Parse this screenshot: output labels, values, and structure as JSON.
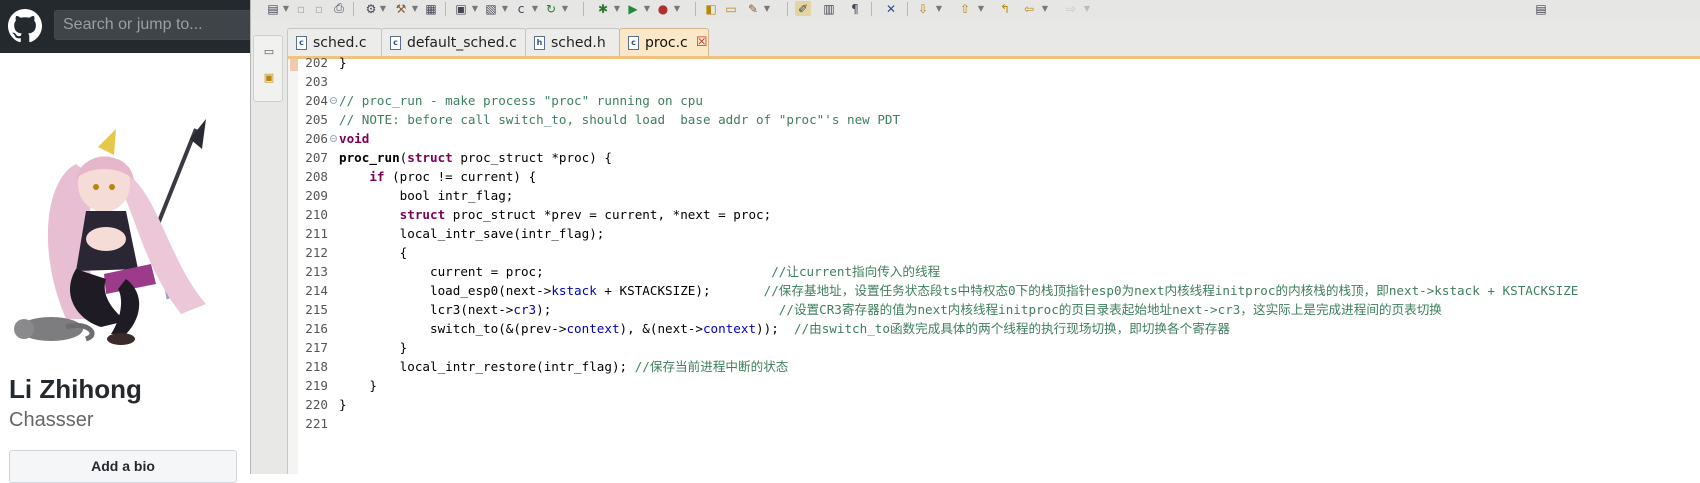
{
  "github": {
    "search_placeholder": "Search or jump to...",
    "profile_name": "Li Zhihong",
    "profile_login": "Chassser",
    "bio_button_label": "Add a bio",
    "header_color": "#24292e"
  },
  "eclipse": {
    "tabs": [
      {
        "label": "sched.c",
        "icon": "c-file-icon"
      },
      {
        "label": "default_sched.c",
        "icon": "c-file-icon"
      },
      {
        "label": "sched.h",
        "icon": "h-file-icon"
      },
      {
        "label": "proc.c",
        "icon": "c-file-icon",
        "active": true
      }
    ],
    "tab_close_glyph": "☒",
    "line_numbers": [
      "202",
      "203",
      "204",
      "205",
      "206",
      "207",
      "208",
      "209",
      "210",
      "211",
      "212",
      "213",
      "214",
      "215",
      "216",
      "217",
      "218",
      "219",
      "220",
      "221"
    ],
    "code": {
      "l202": "}",
      "l204_comment": "// proc_run - make process \"proc\" running on cpu",
      "l205_comment": "// NOTE: before call switch_to, should load  base addr of \"proc\"'s new PDT",
      "l206_kw": "void",
      "l207_fn": "proc_run",
      "l207_paren": "(",
      "l207_kw": "struct",
      "l207_rest": " proc_struct *proc) {",
      "l208_indent": "    ",
      "l208_kw": "if",
      "l208_rest": " (proc != current) {",
      "l209": "        bool intr_flag;",
      "l210_indent": "        ",
      "l210_kw": "struct",
      "l210_rest": " proc_struct *prev = current, *next = proc;",
      "l211": "        local_intr_save(intr_flag);",
      "l212": "        {",
      "l213_code": "            current = proc;                              ",
      "l213_comment": "//让current指向传入的线程",
      "l214_a": "            load_esp0(next->",
      "l214_fld": "kstack",
      "l214_b": " + KSTACKSIZE);       ",
      "l214_comment": "//保存基地址，设置任务状态段ts中特权态0下的栈顶指针esp0为next内核线程initproc的内核栈的栈顶，即next->kstack + KSTACKSIZE",
      "l215_a": "            lcr3(next->",
      "l215_fld": "cr3",
      "l215_b": ");                              ",
      "l215_comment": "//设置CR3寄存器的值为next内核线程initproc的页目录表起始地址next->cr3，这实际上是完成进程间的页表切换",
      "l216_a": "            switch_to(&(prev->",
      "l216_fld1": "context",
      "l216_b": "), &(next->",
      "l216_fld2": "context",
      "l216_c": "));  ",
      "l216_comment": "//由switch_to函数完成具体的两个线程的执行现场切换，即切换各个寄存器",
      "l217": "        }",
      "l218_code": "        local_intr_restore(intr_flag); ",
      "l218_comment": "//保存当前进程中断的状态",
      "l219": "    }",
      "l220": "}",
      "l221": ""
    },
    "colors": {
      "keyword": "#7f0055",
      "comment": "#3f7f5f",
      "field": "#0000c0",
      "active_tab": "#fbe8c8"
    }
  }
}
